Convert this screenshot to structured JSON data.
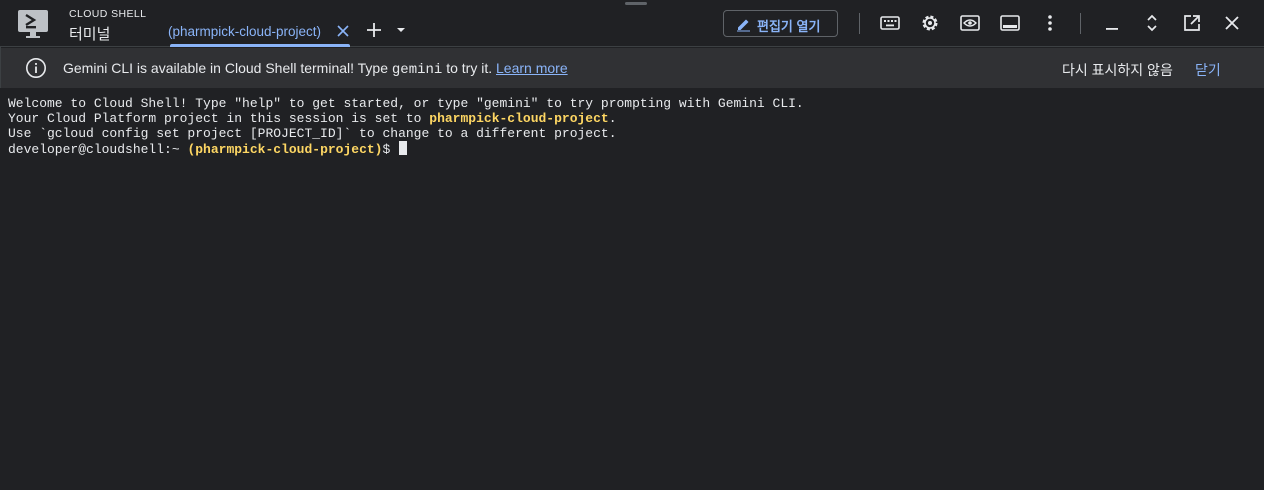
{
  "header": {
    "brand_top": "CLOUD SHELL",
    "brand_bottom": "터미널",
    "tab_label": "(pharmpick-cloud-project)",
    "editor_button": "편집기 열기",
    "icons": [
      "cloud-shell-logo-icon",
      "close-tab-icon",
      "add-tab-icon",
      "tab-menu-arrow-icon",
      "pencil-icon",
      "keyboard-icon",
      "settings-gear-icon",
      "web-preview-icon",
      "terminal-panel-icon",
      "more-vert-icon",
      "minimize-icon",
      "expand-icon",
      "open-new-window-icon",
      "close-icon"
    ]
  },
  "banner": {
    "text_before": "Gemini CLI is available in Cloud Shell terminal! Type ",
    "code": "gemini",
    "text_after": " to try it. ",
    "learn_more": "Learn more",
    "dismiss": "다시 표시하지 않음",
    "close": "닫기"
  },
  "terminal": {
    "line1": "Welcome to Cloud Shell! Type \"help\" to get started, or type \"gemini\" to try prompting with Gemini CLI.",
    "line2_prefix": "Your Cloud Platform project in this session is set to ",
    "project": "pharmpick-cloud-project",
    "line2_suffix": ".",
    "line3": "Use `gcloud config set project [PROJECT_ID]` to change to a different project.",
    "prompt_user": "developer@cloudshell:~",
    "prompt_project": "(pharmpick-cloud-project)",
    "prompt_symbol": "$"
  },
  "colors": {
    "accent": "#8ab4f8",
    "project_highlight": "#fdd663",
    "background": "#202124",
    "banner": "#303134"
  }
}
